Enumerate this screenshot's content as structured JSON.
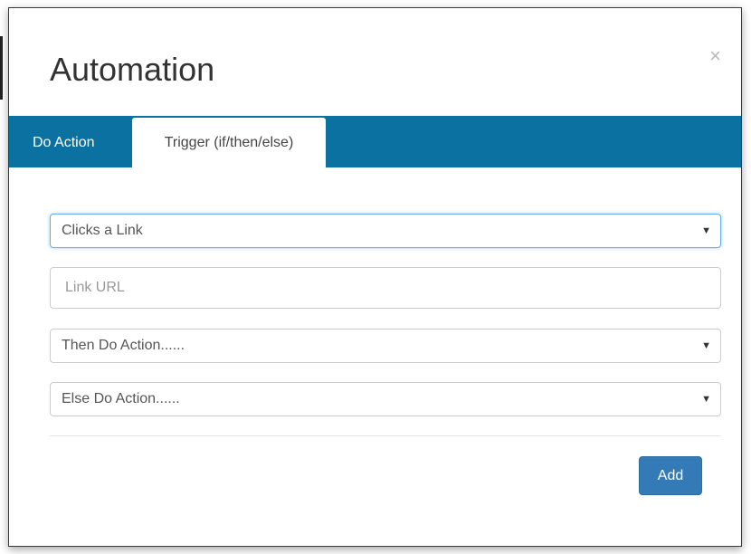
{
  "modal": {
    "title": "Automation",
    "close_glyph": "×"
  },
  "tabs": [
    {
      "label": "Do Action",
      "active": false
    },
    {
      "label": "Trigger (if/then/else)",
      "active": true
    }
  ],
  "form": {
    "trigger_select": {
      "value": "Clicks a Link",
      "focused": true
    },
    "link_url_input": {
      "value": "",
      "placeholder": "Link URL"
    },
    "then_action_select": {
      "value": "Then Do Action......"
    },
    "else_action_select": {
      "value": "Else Do Action......"
    },
    "caret_glyph": "▼"
  },
  "footer": {
    "add_label": "Add"
  },
  "colors": {
    "tab_bar": "#0a71a0",
    "primary_button": "#337ab7",
    "focus_border": "#66afe9"
  }
}
